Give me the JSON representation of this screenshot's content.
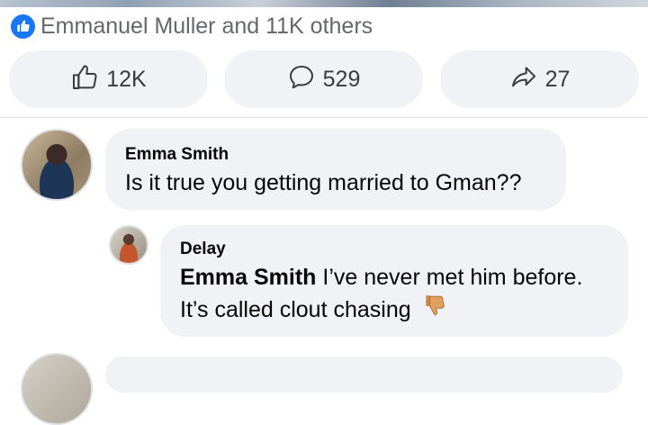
{
  "post": {
    "reactions_summary": "Emmanuel Muller and 11K others",
    "actions": [
      {
        "icon": "thumbs-up-icon",
        "count": "12K"
      },
      {
        "icon": "comment-icon",
        "count": "529"
      },
      {
        "icon": "share-icon",
        "count": "27"
      }
    ]
  },
  "comments": [
    {
      "author": "Emma Smith",
      "text": "Is it true you getting married to Gman??"
    },
    {
      "author": "Delay",
      "mention": "Emma Smith",
      "text_line1": "I’ve never met him before.",
      "text_line2": "It’s called clout chasing",
      "emoji": "thumbs-down-emoji"
    }
  ],
  "colors": {
    "accent": "#1877f2",
    "bubble_bg": "#f0f2f5",
    "secondary_text": "#65676b"
  }
}
